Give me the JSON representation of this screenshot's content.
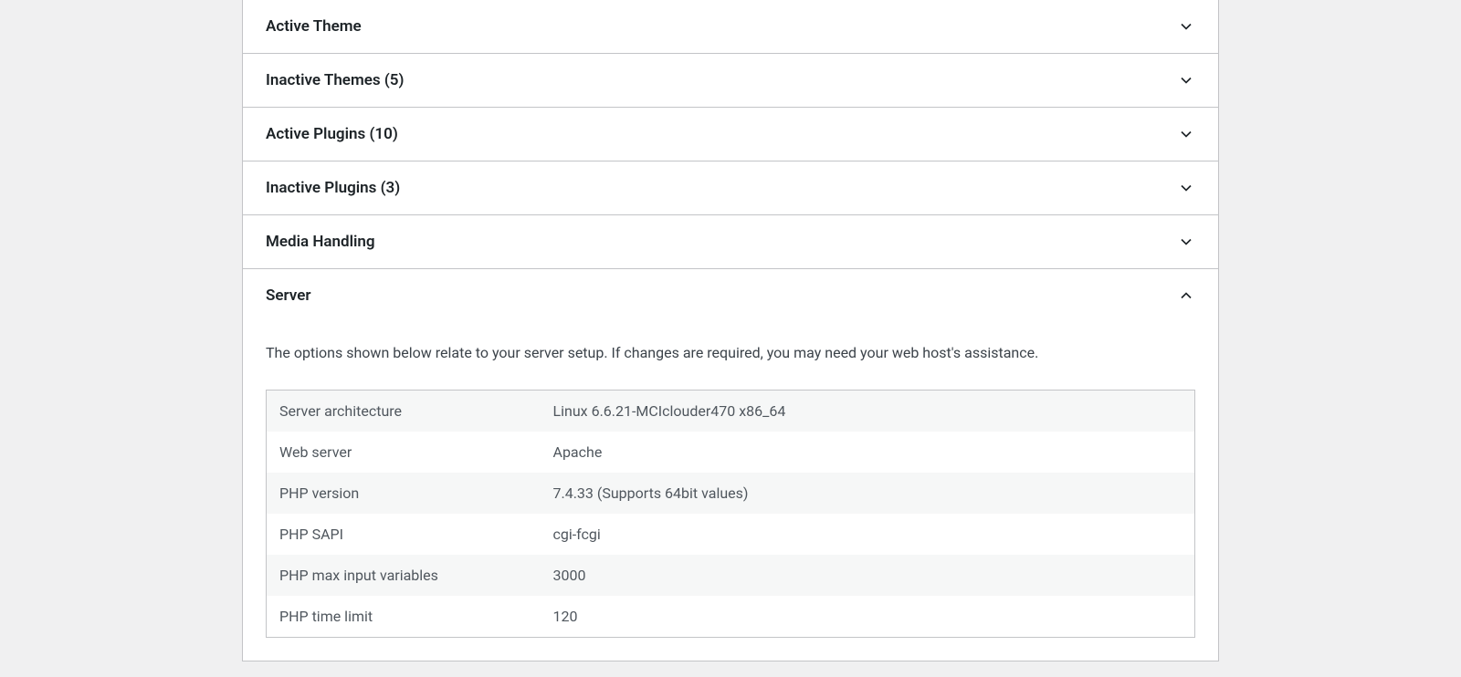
{
  "sections": {
    "activeTheme": {
      "title": "Active Theme"
    },
    "inactiveThemes": {
      "title": "Inactive Themes (5)"
    },
    "activePlugins": {
      "title": "Active Plugins (10)"
    },
    "inactivePlugins": {
      "title": "Inactive Plugins (3)"
    },
    "mediaHandling": {
      "title": "Media Handling"
    },
    "server": {
      "title": "Server",
      "description": "The options shown below relate to your server setup. If changes are required, you may need your web host's assistance.",
      "rows": [
        {
          "label": "Server architecture",
          "value": "Linux 6.6.21-MCIclouder470 x86_64"
        },
        {
          "label": "Web server",
          "value": "Apache"
        },
        {
          "label": "PHP version",
          "value": "7.4.33 (Supports 64bit values)"
        },
        {
          "label": "PHP SAPI",
          "value": "cgi-fcgi"
        },
        {
          "label": "PHP max input variables",
          "value": "3000"
        },
        {
          "label": "PHP time limit",
          "value": "120"
        }
      ]
    }
  }
}
